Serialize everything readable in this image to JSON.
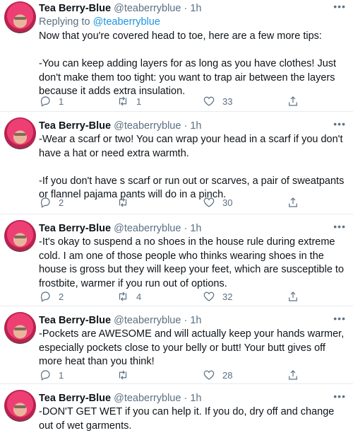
{
  "tweets": [
    {
      "name": "Tea Berry-Blue",
      "handle": "@teaberryblue",
      "separator": "·",
      "time": "1h",
      "replying_prefix": "Replying to",
      "replying_to": "@teaberryblue",
      "paragraphs": [
        "Now that you're covered head to toe, here are a few more tips:",
        "-You can keep adding layers for as long as you have clothes! Just don't make them too tight: you want to trap air between the layers because it adds extra insulation."
      ],
      "replies": "1",
      "retweets": "1",
      "likes": "33"
    },
    {
      "name": "Tea Berry-Blue",
      "handle": "@teaberryblue",
      "separator": "·",
      "time": "1h",
      "paragraphs": [
        "-Wear a scarf or two! You can wrap your head in a scarf if you don't have a hat or need extra warmth.",
        "-If you don't have s scarf or run out or scarves, a pair of sweatpants or flannel pajama pants will do in a pinch."
      ],
      "replies": "2",
      "retweets": "",
      "likes": "30"
    },
    {
      "name": "Tea Berry-Blue",
      "handle": "@teaberryblue",
      "separator": "·",
      "time": "1h",
      "paragraphs": [
        "-It's okay to suspend a no shoes in the house rule during extreme cold. I am one of those people who thinks wearing shoes in the house is gross but they will keep your feet, which are susceptible to frostbite, warmer if you run out of options."
      ],
      "replies": "2",
      "retweets": "4",
      "likes": "32"
    },
    {
      "name": "Tea Berry-Blue",
      "handle": "@teaberryblue",
      "separator": "·",
      "time": "1h",
      "paragraphs": [
        "-Pockets are AWESOME and will actually keep your hands warmer, especially pockets close to your belly or butt! Your butt gives off more heat than you think!"
      ],
      "replies": "1",
      "retweets": "",
      "likes": "28"
    },
    {
      "name": "Tea Berry-Blue",
      "handle": "@teaberryblue",
      "separator": "·",
      "time": "1h",
      "paragraphs": [
        "-DON'T GET WET if you can help it. If you do, dry off and change out of wet garments."
      ]
    }
  ],
  "icons": {
    "reply": "reply-icon",
    "retweet": "retweet-icon",
    "like": "like-icon",
    "share": "share-icon",
    "more": "more-icon"
  },
  "colors": {
    "text": "#0f1419",
    "secondary": "#5b7083",
    "link": "#1b95e0",
    "divider": "#e6ecf0",
    "background": "#ffffff"
  }
}
